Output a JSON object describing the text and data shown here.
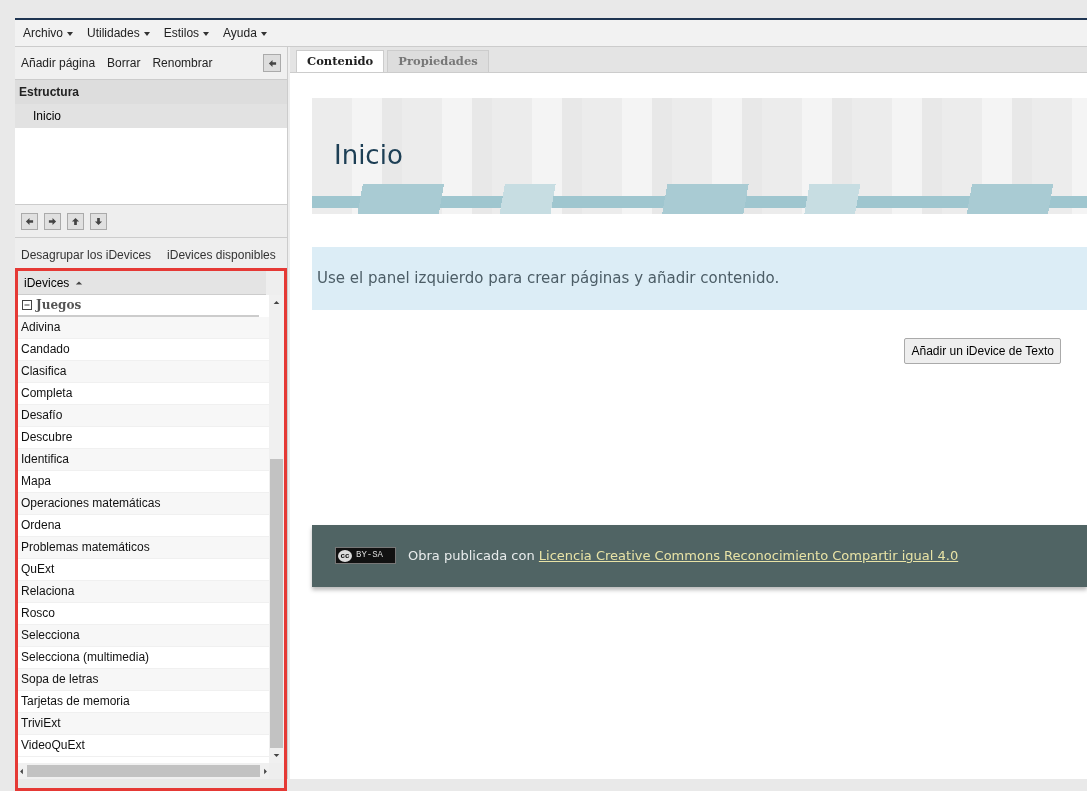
{
  "menu": [
    {
      "label": "Archivo"
    },
    {
      "label": "Utilidades"
    },
    {
      "label": "Estilos"
    },
    {
      "label": "Ayuda"
    }
  ],
  "page_toolbar": {
    "buttons": [
      "Añadir página",
      "Borrar",
      "Renombrar"
    ]
  },
  "structure": {
    "title": "Estructura",
    "pages": [
      {
        "label": "Inicio",
        "selected": true
      }
    ]
  },
  "idevice_links": [
    "Desagrupar los iDevices",
    "iDevices disponibles"
  ],
  "idevices": {
    "header": "iDevices",
    "groups": [
      {
        "label": "Juegos",
        "expanded": true,
        "items": [
          "Adivina",
          "Candado",
          "Clasifica",
          "Completa",
          "Desafío",
          "Descubre",
          "Identifica",
          "Mapa",
          "Operaciones matemáticas",
          "Ordena",
          "Problemas matemáticos",
          "QuExt",
          "Relaciona",
          "Rosco",
          "Selecciona",
          "Selecciona (multimedia)",
          "Sopa de letras",
          "Tarjetas de memoria",
          "TriviExt",
          "VideoQuExt"
        ]
      }
    ]
  },
  "tabs": [
    {
      "label": "Contenido",
      "selected": true
    },
    {
      "label": "Propiedades",
      "selected": false
    }
  ],
  "page": {
    "title": "Inicio",
    "notice": "Use el panel izquierdo para crear páginas y añadir contenido.",
    "add_button": "Añadir un iDevice de Texto",
    "footer": {
      "badge_left": "cc",
      "badge_right": "BY-SA",
      "text": "Obra publicada con",
      "link": "Licencia Creative Commons Reconocimiento Compartir igual 4.0"
    }
  }
}
